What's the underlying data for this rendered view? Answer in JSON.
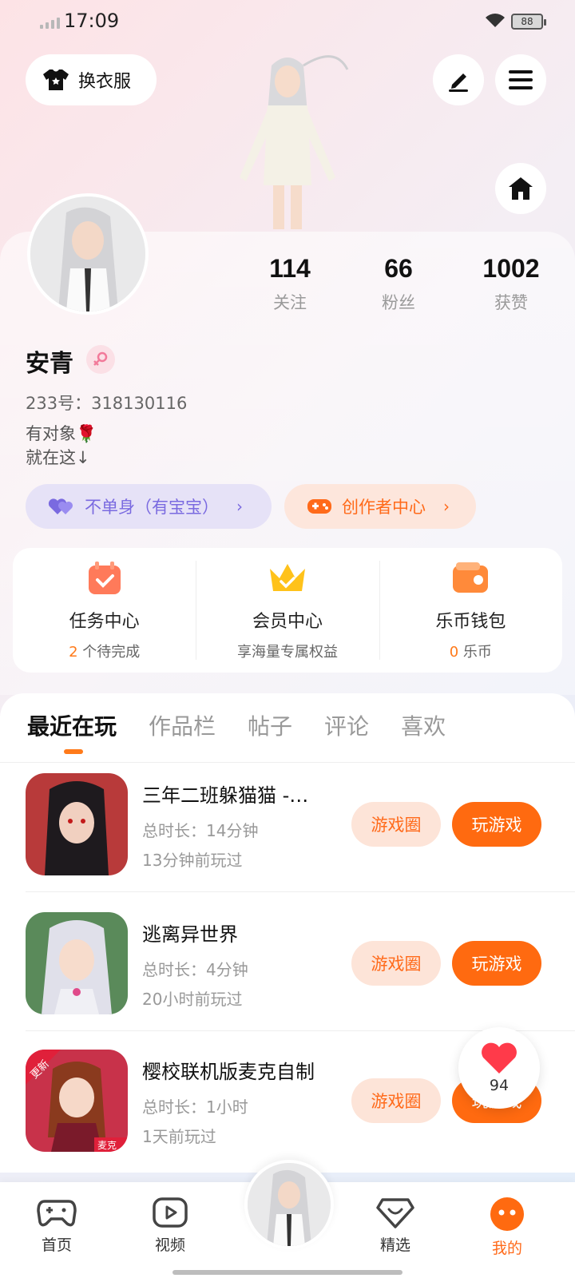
{
  "status": {
    "time": "17:09",
    "battery": "88"
  },
  "top": {
    "outfit_label": "换衣服"
  },
  "profile": {
    "stats": [
      {
        "value": "114",
        "label": "关注"
      },
      {
        "value": "66",
        "label": "粉丝"
      },
      {
        "value": "1002",
        "label": "获赞"
      }
    ],
    "name": "安青",
    "uid": "233号：318130116",
    "bio_line1": "有对象🌹",
    "bio_line2": "就在这↓",
    "tag_single": "不单身（有宝宝）",
    "tag_creator": "创作者中心"
  },
  "services": [
    {
      "title": "任务中心",
      "sub_hl": "2",
      "sub": " 个待完成"
    },
    {
      "title": "会员中心",
      "sub_hl": "",
      "sub": "享海量专属权益"
    },
    {
      "title": "乐币钱包",
      "sub_hl": "0",
      "sub": " 乐币"
    }
  ],
  "tabs": [
    "最近在玩",
    "作品栏",
    "帖子",
    "评论",
    "喜欢"
  ],
  "games": [
    {
      "title": "三年二班躲猫猫 -…",
      "duration": "总时长：14分钟",
      "last": "13分钟前玩过",
      "circle_btn": "游戏圈",
      "play_btn": "玩游戏",
      "icon_color": "#b83a3a"
    },
    {
      "title": "逃离异世界",
      "duration": "总时长：4分钟",
      "last": "20小时前玩过",
      "circle_btn": "游戏圈",
      "play_btn": "玩游戏",
      "icon_color": "#5a8a5a"
    },
    {
      "title": "樱校联机版麦克自制",
      "duration": "总时长：1小时",
      "last": "1天前玩过",
      "circle_btn": "游戏圈",
      "play_btn": "玩游戏",
      "icon_color": "#c8324a",
      "badge": "更新",
      "corner_label": "麦克"
    }
  ],
  "floating": {
    "heart_count": "94"
  },
  "nav": [
    {
      "label": "首页",
      "icon": "gamepad-icon"
    },
    {
      "label": "视频",
      "icon": "video-icon"
    },
    {
      "label": "精选",
      "icon": "heart-chat-icon"
    },
    {
      "label": "我的",
      "icon": "profile-face-icon"
    }
  ],
  "colors": {
    "accent": "#ff6a10",
    "accent_light": "#fde4d8",
    "purple": "#7a6ae0"
  }
}
